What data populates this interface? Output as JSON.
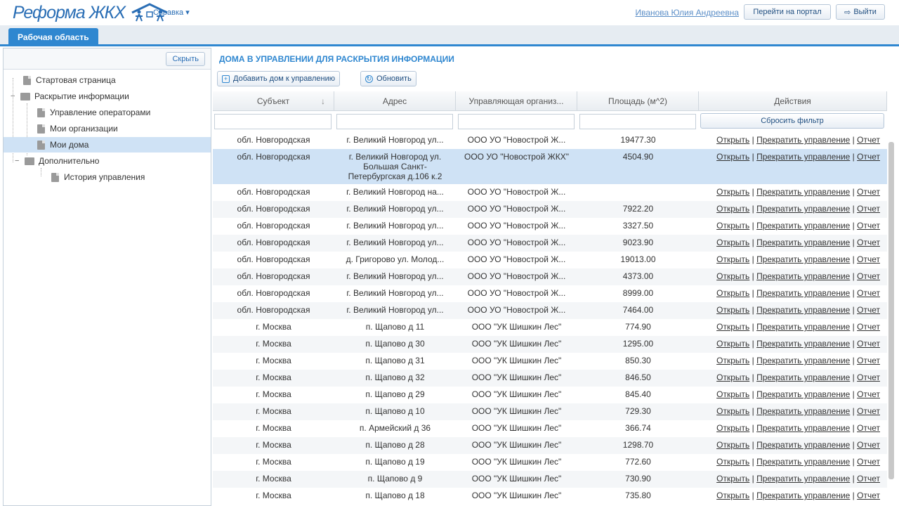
{
  "header": {
    "logo_text": "Реформа ЖКХ",
    "help_label": "Справка",
    "user_name": "Иванова Юлия Андреевна",
    "portal_button": "Перейти на портал",
    "logout_button": "Выйти"
  },
  "tabs": {
    "workspace": "Рабочая область"
  },
  "sidebar": {
    "hide_button": "Скрыть",
    "items": [
      {
        "label": "Стартовая страница"
      },
      {
        "label": "Раскрытие информации"
      },
      {
        "label": "Управление операторами"
      },
      {
        "label": "Мои организации"
      },
      {
        "label": "Мои дома"
      },
      {
        "label": "Дополнительно"
      },
      {
        "label": "История управления"
      }
    ]
  },
  "main": {
    "title": "ДОМА В УПРАВЛЕНИИ ДЛЯ РАСКРЫТИЯ ИНФОРМАЦИИ",
    "add_button": "Добавить дом к управлению",
    "refresh_button": "Обновить"
  },
  "grid": {
    "columns": [
      "Субъект",
      "Адрес",
      "Управляющая организ...",
      "Площадь (м^2)",
      "Действия"
    ],
    "sort_icon": "arrow-down-icon",
    "reset_filter": "Сбросить фильтр",
    "action_open": "Открыть",
    "action_stop": "Прекратить управление",
    "action_report": "Отчет",
    "sep": "|",
    "rows": [
      [
        "обл. Новгородская",
        "г. Великий Новгород ул...",
        "ООО УО \"Новострой Ж...",
        "19477.30"
      ],
      [
        "обл. Новгородская",
        "г. Великий Новгород ул. Большая Санкт-Петербургская д.106 к.2",
        "ООО УО \"Новострой ЖКХ\"",
        "4504.90"
      ],
      [
        "обл. Новгородская",
        "г. Великий Новгород на...",
        "ООО УО \"Новострой Ж...",
        ""
      ],
      [
        "обл. Новгородская",
        "г. Великий Новгород ул...",
        "ООО УО \"Новострой Ж...",
        "7922.20"
      ],
      [
        "обл. Новгородская",
        "г. Великий Новгород ул...",
        "ООО УО \"Новострой Ж...",
        "3327.50"
      ],
      [
        "обл. Новгородская",
        "г. Великий Новгород ул...",
        "ООО УО \"Новострой Ж...",
        "9023.90"
      ],
      [
        "обл. Новгородская",
        "д. Григорово ул. Молод...",
        "ООО УО \"Новострой Ж...",
        "19013.00"
      ],
      [
        "обл. Новгородская",
        "г. Великий Новгород ул...",
        "ООО УО \"Новострой Ж...",
        "4373.00"
      ],
      [
        "обл. Новгородская",
        "г. Великий Новгород ул...",
        "ООО УО \"Новострой Ж...",
        "8999.00"
      ],
      [
        "обл. Новгородская",
        "г. Великий Новгород ул...",
        "ООО УО \"Новострой Ж...",
        "7464.00"
      ],
      [
        "г. Москва",
        "п. Щапово д 11",
        "ООО \"УК Шишкин Лес\"",
        "774.90"
      ],
      [
        "г. Москва",
        "п. Щапово д 30",
        "ООО \"УК Шишкин Лес\"",
        "1295.00"
      ],
      [
        "г. Москва",
        "п. Щапово д 31",
        "ООО \"УК Шишкин Лес\"",
        "850.30"
      ],
      [
        "г. Москва",
        "п. Щапово д 32",
        "ООО \"УК Шишкин Лес\"",
        "846.50"
      ],
      [
        "г. Москва",
        "п. Щапово д 29",
        "ООО \"УК Шишкин Лес\"",
        "845.40"
      ],
      [
        "г. Москва",
        "п. Щапово д 10",
        "ООО \"УК Шишкин Лес\"",
        "729.30"
      ],
      [
        "г. Москва",
        "п. Армейский д 36",
        "ООО \"УК Шишкин Лес\"",
        "366.74"
      ],
      [
        "г. Москва",
        "п. Щапово д 28",
        "ООО \"УК Шишкин Лес\"",
        "1298.70"
      ],
      [
        "г. Москва",
        "п. Щапово д 19",
        "ООО \"УК Шишкин Лес\"",
        "772.60"
      ],
      [
        "г. Москва",
        "п. Щапово д 9",
        "ООО \"УК Шишкин Лес\"",
        "730.90"
      ],
      [
        "г. Москва",
        "п. Щапово д 18",
        "ООО \"УК Шишкин Лес\"",
        "735.80"
      ]
    ]
  }
}
